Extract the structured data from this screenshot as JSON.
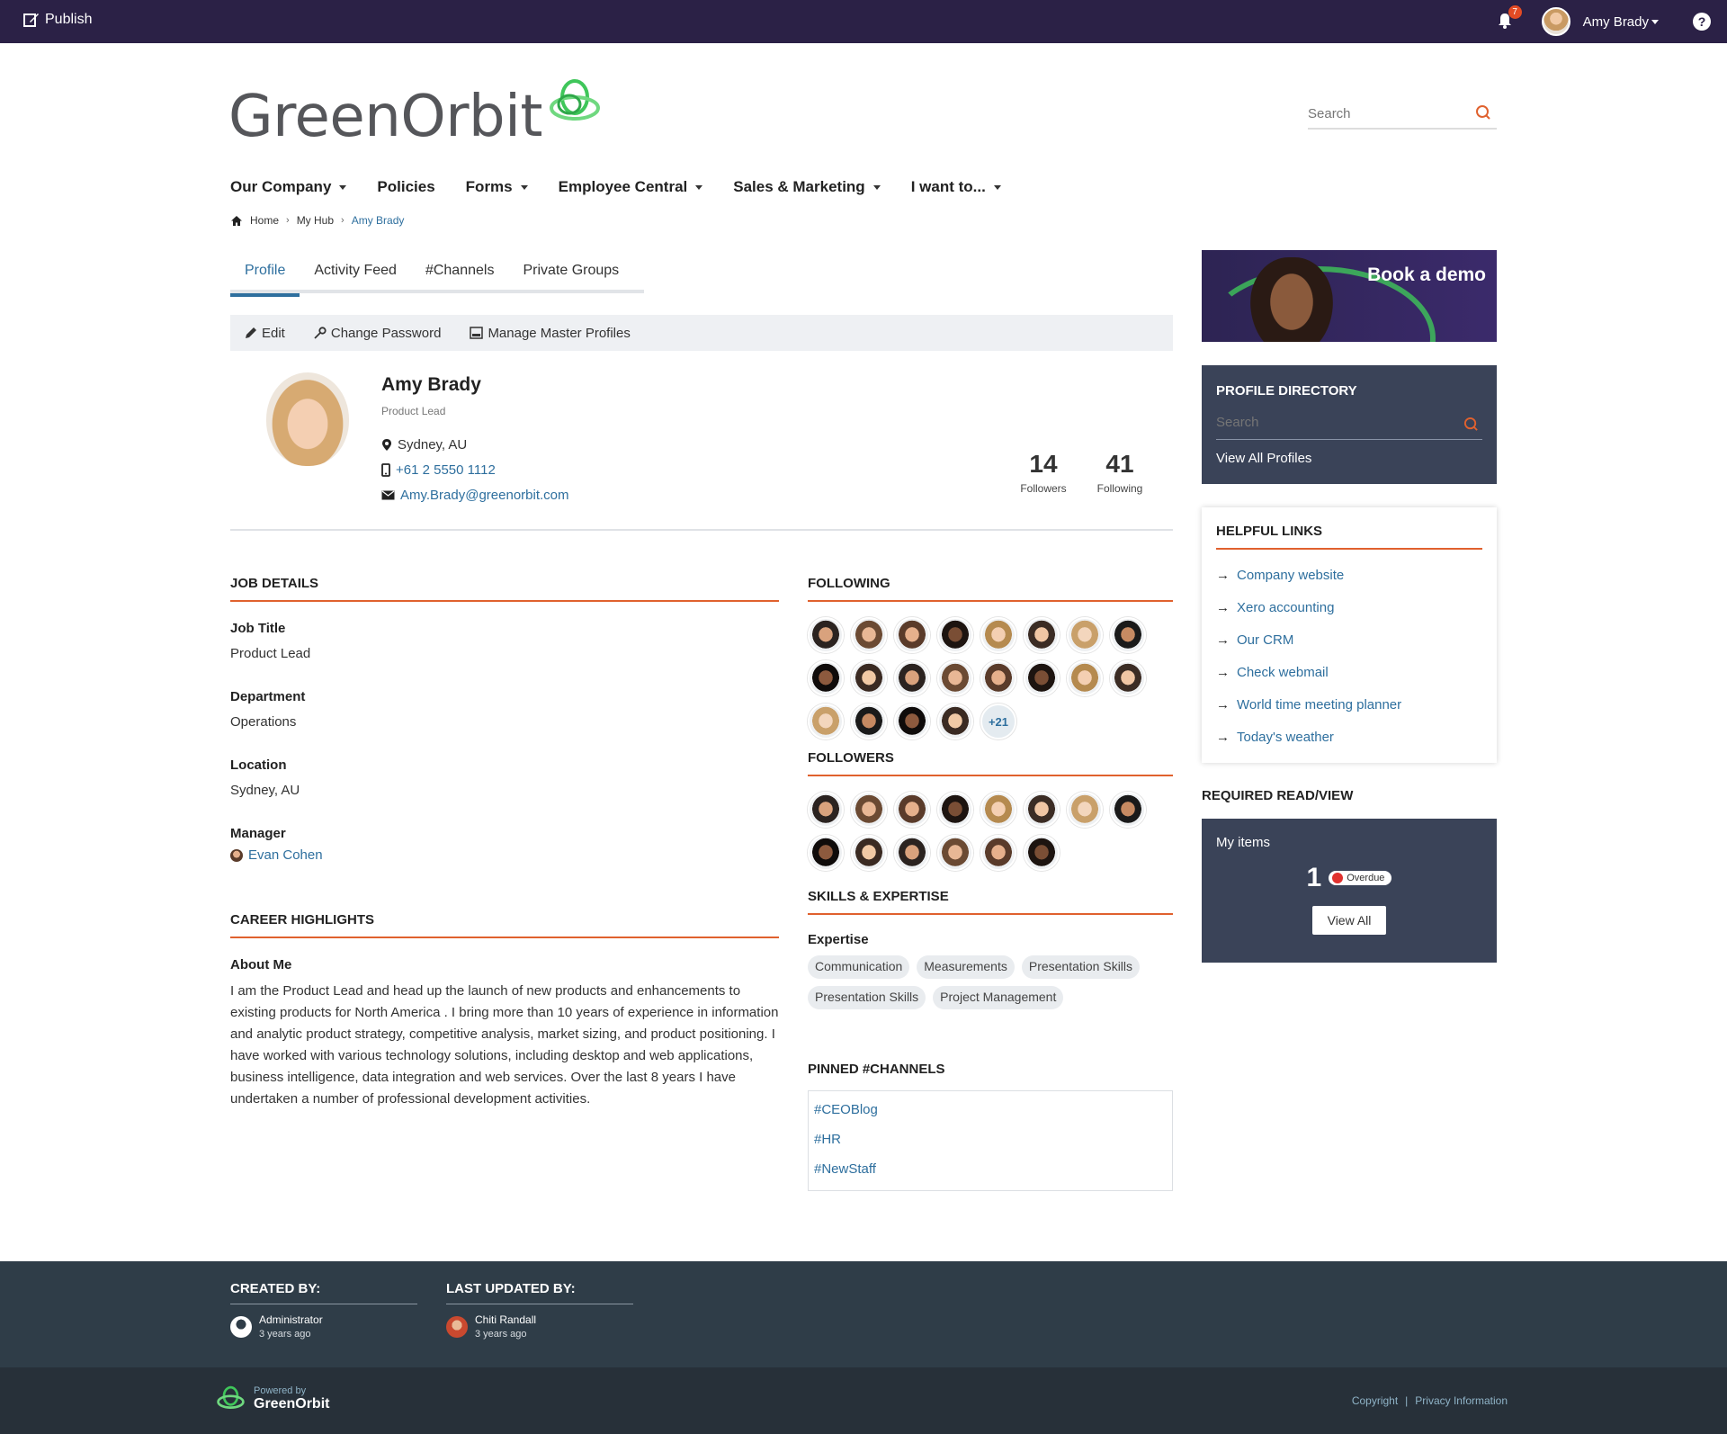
{
  "topbar": {
    "publish_label": "Publish",
    "notification_count": "7",
    "user_name": "Amy Brady",
    "help_label": "?"
  },
  "header": {
    "logo_text": "GreenOrbit",
    "search_placeholder": "Search"
  },
  "nav": {
    "items": [
      {
        "label": "Our Company",
        "dropdown": true
      },
      {
        "label": "Policies",
        "dropdown": false
      },
      {
        "label": "Forms",
        "dropdown": true
      },
      {
        "label": "Employee Central",
        "dropdown": true
      },
      {
        "label": "Sales & Marketing",
        "dropdown": true
      },
      {
        "label": "I want to...",
        "dropdown": true
      }
    ]
  },
  "breadcrumb": {
    "home": "Home",
    "hub": "My Hub",
    "current": "Amy Brady"
  },
  "tabs": [
    "Profile",
    "Activity Feed",
    "#Channels",
    "Private Groups"
  ],
  "toolbar": {
    "edit": "Edit",
    "change_password": "Change Password",
    "manage_profiles": "Manage Master Profiles"
  },
  "profile": {
    "name": "Amy Brady",
    "role": "Product Lead",
    "location": "Sydney, AU",
    "phone": "+61 2 5550 1112",
    "email": "Amy.Brady@greenorbit.com",
    "followers_count": "14",
    "followers_label": "Followers",
    "following_count": "41",
    "following_label": "Following"
  },
  "job_details": {
    "title": "JOB DETAILS",
    "job_title_label": "Job Title",
    "job_title": "Product Lead",
    "department_label": "Department",
    "department": "Operations",
    "location_label": "Location",
    "location": "Sydney, AU",
    "manager_label": "Manager",
    "manager": "Evan Cohen"
  },
  "career": {
    "title": "CAREER HIGHLIGHTS",
    "about_label": "About Me",
    "about": "I am the Product Lead and head up the launch of new products and enhancements to existing products for North America . I bring more than 10 years of experience in information and analytic product strategy, competitive analysis, market sizing, and product positioning. I have worked with various technology solutions, including desktop and web applications, business intelligence, data integration and web services. Over the last 8 years I have undertaken a number of professional development activities."
  },
  "following": {
    "title": "FOLLOWING",
    "visible_avatars": 20,
    "more_label": "+21"
  },
  "followers": {
    "title": "FOLLOWERS",
    "visible_avatars": 14
  },
  "skills": {
    "title": "SKILLS & EXPERTISE",
    "expertise_label": "Expertise",
    "chips": [
      "Communication",
      "Measurements",
      "Presentation Skills",
      "Presentation Skills",
      "Project Management"
    ]
  },
  "pinned": {
    "title": "PINNED #CHANNELS",
    "channels": [
      "#CEOBlog",
      "#HR",
      "#NewStaff"
    ]
  },
  "sidebar": {
    "banner_text": "Book a demo",
    "directory_title": "PROFILE DIRECTORY",
    "directory_search_placeholder": "Search",
    "view_all_profiles": "View All Profiles",
    "helpful_title": "HELPFUL LINKS",
    "helpful_links": [
      "Company website",
      "Xero accounting",
      "Our CRM",
      "Check webmail",
      "World time meeting planner",
      "Today's weather"
    ],
    "required_title": "REQUIRED READ/VIEW",
    "my_items": "My items",
    "items_count": "1",
    "overdue_label": "Overdue",
    "view_all": "View All"
  },
  "footer": {
    "created_title": "CREATED BY:",
    "created_name": "Administrator",
    "created_time": "3 years ago",
    "updated_title": "LAST UPDATED BY:",
    "updated_name": "Chiti Randall",
    "updated_time": "3 years ago",
    "powered_by": "Powered by",
    "brand": "GreenOrbit",
    "copyright": "Copyright",
    "separator": "|",
    "privacy": "Privacy Information"
  },
  "colors": {
    "topbar": "#2b2146",
    "accent_orange": "#e0612e",
    "link_blue": "#2e6f9e",
    "panel_dark": "#3a4358",
    "footer_dark": "#2f3d48",
    "brand_green": "#3fc65a"
  }
}
